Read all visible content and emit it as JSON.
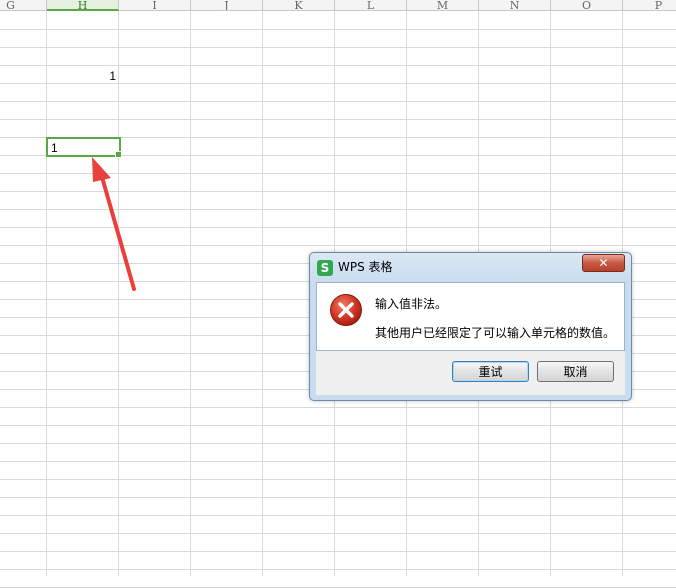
{
  "sheet": {
    "columns": [
      "G",
      "H",
      "I",
      "J",
      "K",
      "L",
      "M",
      "N",
      "O",
      "P"
    ],
    "active_column": "H",
    "cell_h4_value": "1",
    "active_cell_value": "1"
  },
  "dialog": {
    "title": "WPS 表格",
    "app_icon_glyph": "S",
    "close_glyph": "✕",
    "message_title": "输入值非法。",
    "message_detail": "其他用户已经限定了可以输入单元格的数值。",
    "retry_label": "重试",
    "cancel_label": "取消"
  },
  "colors": {
    "selection": "#5aa845",
    "arrow": "#e8403a",
    "error_icon": "#c42b1c"
  },
  "icons": {
    "error": "error-x-circle-icon",
    "close": "close-icon",
    "app": "wps-spreadsheet-icon"
  }
}
